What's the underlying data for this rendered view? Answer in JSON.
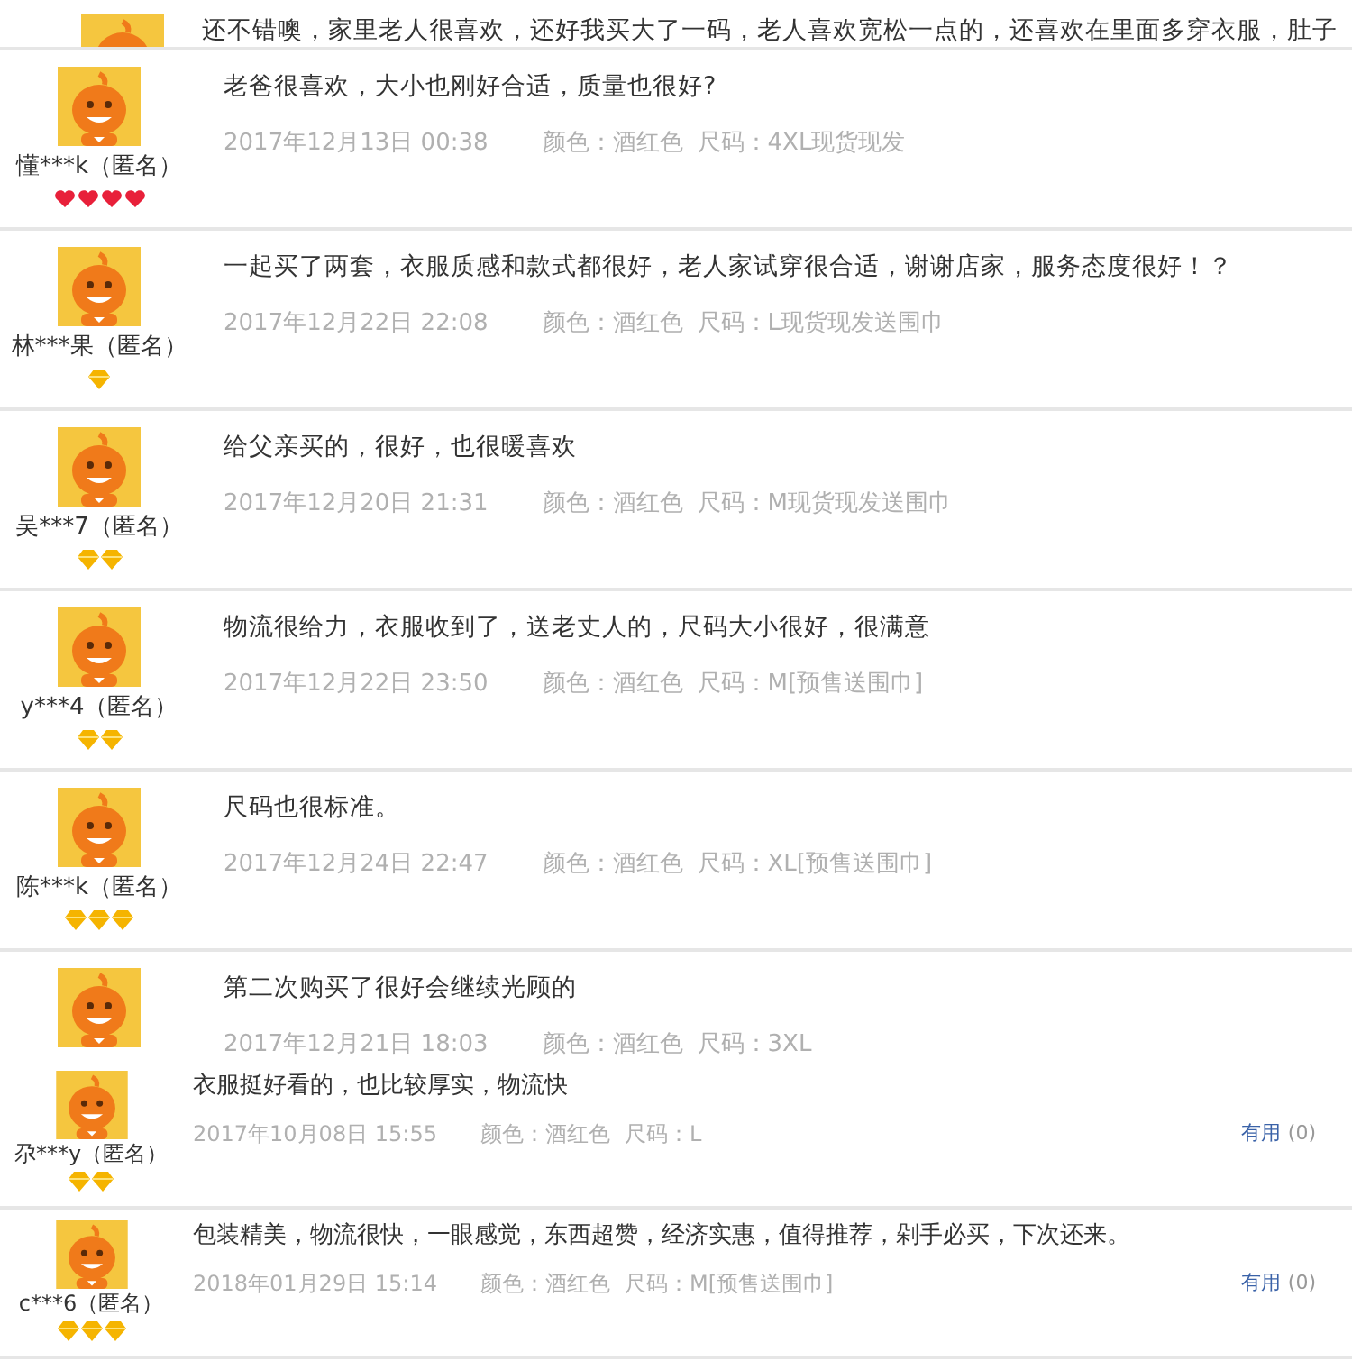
{
  "reviews": [
    {
      "kind": "partial",
      "text": "还不错噢，家里老人很喜欢，还好我买大了一码，老人喜欢宽松一点的，还喜欢在里面多穿衣服，肚子"
    },
    {
      "kind": "large",
      "user": "懂***k（匿名）",
      "badges": [
        {
          "kind": "heart"
        },
        {
          "kind": "heart"
        },
        {
          "kind": "heart"
        },
        {
          "kind": "heart"
        }
      ],
      "text": "老爸很喜欢，大小也刚好合适，质量也很好?",
      "date": "2017年12月13日 00:38",
      "option_color": "颜色：酒红色",
      "option_size": "尺码：4XL现货现发"
    },
    {
      "kind": "large",
      "user": "林***果（匿名）",
      "badges": [
        {
          "kind": "diamond"
        }
      ],
      "text": "一起买了两套，衣服质感和款式都很好，老人家试穿很合适，谢谢店家，服务态度很好！？",
      "date": "2017年12月22日 22:08",
      "option_color": "颜色：酒红色",
      "option_size": "尺码：L现货现发送围巾"
    },
    {
      "kind": "large",
      "user": "吴***7（匿名）",
      "badges": [
        {
          "kind": "diamond"
        },
        {
          "kind": "diamond"
        }
      ],
      "text": "给父亲买的，很好，也很暖喜欢",
      "date": "2017年12月20日 21:31",
      "option_color": "颜色：酒红色",
      "option_size": "尺码：M现货现发送围巾"
    },
    {
      "kind": "large",
      "user": "y***4（匿名）",
      "badges": [
        {
          "kind": "diamond"
        },
        {
          "kind": "diamond"
        }
      ],
      "text": "物流很给力，衣服收到了，送老丈人的，尺码大小很好，很满意",
      "date": "2017年12月22日 23:50",
      "option_color": "颜色：酒红色",
      "option_size": "尺码：M[预售送围巾]"
    },
    {
      "kind": "large",
      "user": "陈***k（匿名）",
      "badges": [
        {
          "kind": "diamond"
        },
        {
          "kind": "diamond"
        },
        {
          "kind": "diamond"
        }
      ],
      "text": "尺码也很标准。",
      "date": "2017年12月24日 22:47",
      "option_color": "颜色：酒红色",
      "option_size": "尺码：XL[预售送围巾]"
    },
    {
      "kind": "clipped",
      "text": "第二次购买了很好会继续光顾的",
      "date": "2017年12月21日 18:03",
      "option_color": "颜色：酒红色",
      "option_size": "尺码：3XL"
    },
    {
      "kind": "compact",
      "user": "尕***y（匿名）",
      "badges": [
        {
          "kind": "diamond"
        },
        {
          "kind": "diamond"
        }
      ],
      "text": "衣服挺好看的，也比较厚实，物流快",
      "date": "2017年10月08日 15:55",
      "option_color": "颜色：酒红色",
      "option_size": "尺码：L",
      "useful_label": "有用",
      "useful_count": "(0)"
    },
    {
      "kind": "compact",
      "user": "c***6（匿名）",
      "badges": [
        {
          "kind": "diamond"
        },
        {
          "kind": "diamond"
        },
        {
          "kind": "diamond"
        }
      ],
      "text": "包装精美，物流很快，一眼感觉，东西超赞，经济实惠，值得推荐，剁手必买，下次还来。",
      "date": "2018年01月29日 15:14",
      "option_color": "颜色：酒红色",
      "option_size": "尺码：M[预售送围巾]",
      "useful_label": "有用",
      "useful_count": "(0)"
    }
  ]
}
